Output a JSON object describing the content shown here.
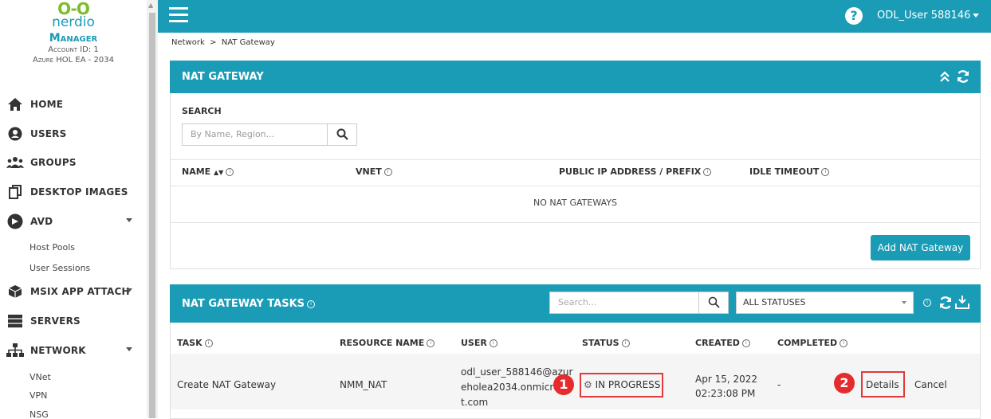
{
  "brand": {
    "logo_icon": "O-O",
    "logo_text": "nerdio",
    "product": "Manager",
    "account_id": "Account ID: 1",
    "account_name": "Azure HOL EA - 2034"
  },
  "sidebar": {
    "items": [
      {
        "label": "HOME",
        "icon": "home-icon"
      },
      {
        "label": "USERS",
        "icon": "user-icon"
      },
      {
        "label": "GROUPS",
        "icon": "group-icon"
      },
      {
        "label": "DESKTOP IMAGES",
        "icon": "copy-icon"
      },
      {
        "label": "AVD",
        "icon": "avd-icon"
      },
      {
        "label": "MSIX APP ATTACH",
        "icon": "box-icon"
      },
      {
        "label": "SERVERS",
        "icon": "server-icon"
      },
      {
        "label": "NETWORK",
        "icon": "sitemap-icon"
      }
    ],
    "avd_sub": [
      "Host Pools",
      "User Sessions"
    ],
    "network_sub": [
      "VNet",
      "VPN",
      "NSG"
    ]
  },
  "topbar": {
    "user": "ODL_User 588146",
    "help_icon": "question-icon"
  },
  "breadcrumb": "Network  >  NAT Gateway",
  "nat_gateway": {
    "title": "NAT GATEWAY",
    "search_label": "SEARCH",
    "search_placeholder": "By Name, Region...",
    "columns": [
      "NAME",
      "VNET",
      "PUBLIC IP ADDRESS / PREFIX",
      "IDLE TIMEOUT"
    ],
    "empty_text": "NO NAT GATEWAYS",
    "add_button": "Add NAT Gateway"
  },
  "tasks": {
    "title": "NAT GATEWAY TASKS",
    "search_placeholder": "Search...",
    "status_filter": "ALL STATUSES",
    "columns": [
      "TASK",
      "RESOURCE NAME",
      "USER",
      "STATUS",
      "CREATED",
      "COMPLETED"
    ],
    "rows": [
      {
        "task": "Create NAT Gateway",
        "resource": "NMM_NAT",
        "user_lines": [
          "odl_user_588146@azur",
          "eholea2034.onmicrc",
          "t.com"
        ],
        "status": "IN PROGRESS",
        "created_lines": [
          "Apr 15, 2022",
          "02:23:08 PM"
        ],
        "completed": "-",
        "details": "Details",
        "cancel": "Cancel"
      }
    ]
  },
  "annotations": [
    "1",
    "2"
  ],
  "colors": {
    "accent": "#1a9bb6",
    "highlight": "#e03a3a"
  }
}
